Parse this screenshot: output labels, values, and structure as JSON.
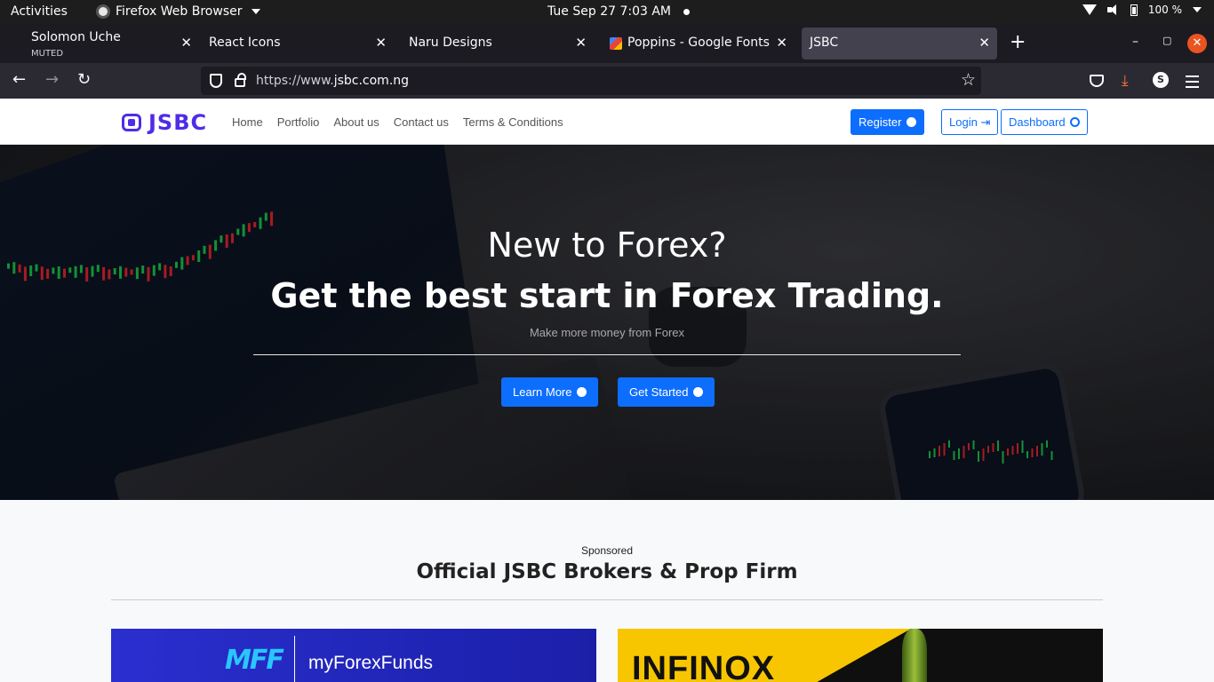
{
  "system_bar": {
    "activities": "Activities",
    "app_name": "Firefox Web Browser",
    "clock": "Tue Sep 27  7:03 AM",
    "battery": "100 %"
  },
  "tabs": [
    {
      "title": "Solomon Uche",
      "subtitle": "MUTED"
    },
    {
      "title": "React Icons"
    },
    {
      "title": "Naru Designs"
    },
    {
      "title": "Poppins - Google Fonts"
    },
    {
      "title": "JSBC",
      "active": true
    }
  ],
  "toolbar": {
    "url_prefix": "https://www.",
    "url_domain": "jsbc.com.ng",
    "account_initial": "S"
  },
  "site": {
    "logo_text": "JSBC",
    "nav": [
      "Home",
      "Portfolio",
      "About us",
      "Contact us",
      "Terms & Conditions"
    ],
    "register": "Register",
    "login": "Login",
    "dashboard": "Dashboard"
  },
  "hero": {
    "title1": "New to Forex?",
    "title2": "Get the best start in Forex Trading.",
    "subtitle": "Make more money from Forex",
    "learn_more": "Learn More",
    "get_started": "Get Started"
  },
  "sponsored": {
    "label": "Sponsored",
    "title": "Official JSBC Brokers & Prop Firm",
    "mff_mark": "MFF",
    "mff_name": "myForexFunds",
    "infinox": "INFINOX"
  },
  "colors": {
    "primary": "#0d6efd",
    "brand": "#4f2ce6",
    "firefox_close": "#e95420"
  }
}
